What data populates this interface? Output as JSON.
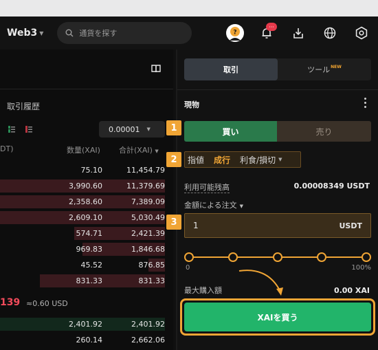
{
  "header": {
    "web3_label": "Web3",
    "search_placeholder": "通貨を探す",
    "notification_badge": "···"
  },
  "orderbook": {
    "title": "取引履歴",
    "precision": "0.00001",
    "col_left": "DT)",
    "col_qty": "数量(XAI)",
    "col_total": "合計(XAI)",
    "asks": [
      {
        "qty": "75.10",
        "total": "11,454.79",
        "fill": 0
      },
      {
        "qty": "3,990.60",
        "total": "11,379.69",
        "fill": 1.0
      },
      {
        "qty": "2,358.60",
        "total": "7,389.09",
        "fill": 1.0
      },
      {
        "qty": "2,609.10",
        "total": "5,030.49",
        "fill": 1.0
      },
      {
        "qty": "574.71",
        "total": "2,421.39",
        "fill": 0.55
      },
      {
        "qty": "969.83",
        "total": "1,846.68",
        "fill": 0.5
      },
      {
        "qty": "45.52",
        "total": "876.85",
        "fill": 0.1
      },
      {
        "qty": "831.33",
        "total": "831.33",
        "fill": 0.76
      }
    ],
    "mid_price": "139",
    "mid_usd": "≈0.60 USD",
    "bids": [
      {
        "qty": "2,401.92",
        "total": "2,401.92",
        "fill": 1.0
      },
      {
        "qty": "260.14",
        "total": "2,662.06",
        "fill": 0
      }
    ]
  },
  "trade": {
    "tab_trade": "取引",
    "tab_tools": "ツール",
    "tab_tools_badge": "NEW",
    "spot_title": "現物",
    "buy_label": "買い",
    "sell_label": "売り",
    "order_limit": "指値",
    "order_market": "成行",
    "order_tpsl": "利食/損切",
    "avail_label": "利用可能残高",
    "avail_value": "0.00008349 USDT",
    "amount_label": "金額による注文",
    "amount_value": "1",
    "amount_unit": "USDT",
    "slider_min": "0",
    "slider_max": "100%",
    "maxbuy_label": "最大購入額",
    "maxbuy_value": "0.00 XAI",
    "submit_label": "XAIを買う"
  },
  "steps": [
    "1",
    "2",
    "3"
  ],
  "colors": {
    "accent": "#f0a535",
    "buy": "#22b46a",
    "sell": "#f24b5b"
  }
}
